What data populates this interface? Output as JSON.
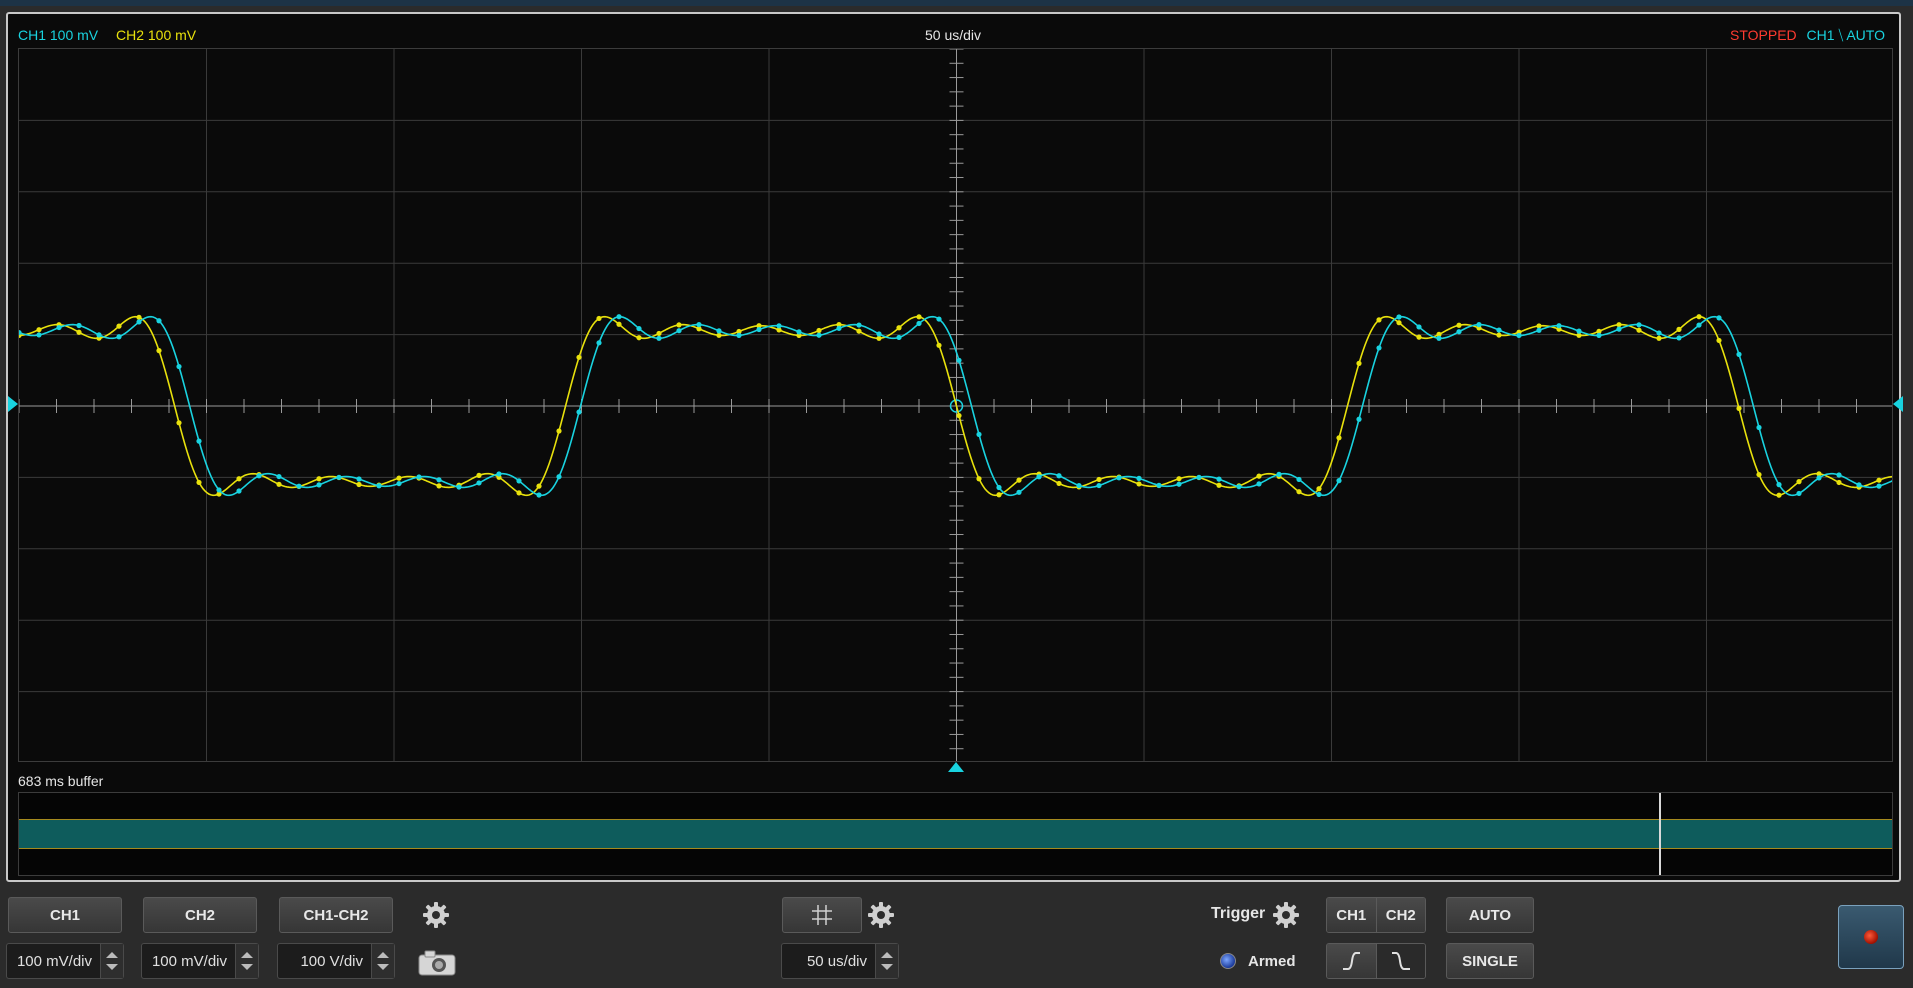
{
  "header": {
    "ch1_scale": "CH1 100 mV",
    "ch2_scale": "CH2 100 mV",
    "timebase": "50 us/div",
    "status": "STOPPED",
    "trigger_summary": "CH1 ⧹ AUTO"
  },
  "buffer": {
    "label": "683 ms buffer",
    "cursor_fraction": 0.875
  },
  "controls": {
    "ch1_button": "CH1",
    "ch2_button": "CH2",
    "math_button": "CH1-CH2",
    "ch1_scale": "100 mV/div",
    "ch2_scale": "100 mV/div",
    "math_scale": "100 V/div",
    "timebase": "50 us/div",
    "trigger_label": "Trigger",
    "armed_label": "Armed",
    "trigger_source": [
      "CH1",
      "CH2"
    ],
    "auto_button": "AUTO",
    "single_button": "SINGLE"
  },
  "icons": [
    "gear-icon",
    "camera-icon",
    "grid-icon",
    "rising-edge-icon",
    "falling-edge-icon",
    "record-icon"
  ],
  "colors": {
    "ch1": "#19d3e0",
    "ch2": "#e8e10c",
    "status": "#ff3b30",
    "grid": "#3a3a3a"
  },
  "chart_data": {
    "type": "line",
    "x_divisions": 10,
    "y_divisions": 10,
    "series": [
      {
        "name": "CH1",
        "amplitude_div": 1.15,
        "period_div": 4.17,
        "ringing_div": 0.1,
        "delay_div": 0.08
      },
      {
        "name": "CH2",
        "amplitude_div": 1.15,
        "period_div": 4.17,
        "ringing_div": 0.18,
        "delay_div": 0.0
      }
    ],
    "trigger_level_div": 0
  }
}
